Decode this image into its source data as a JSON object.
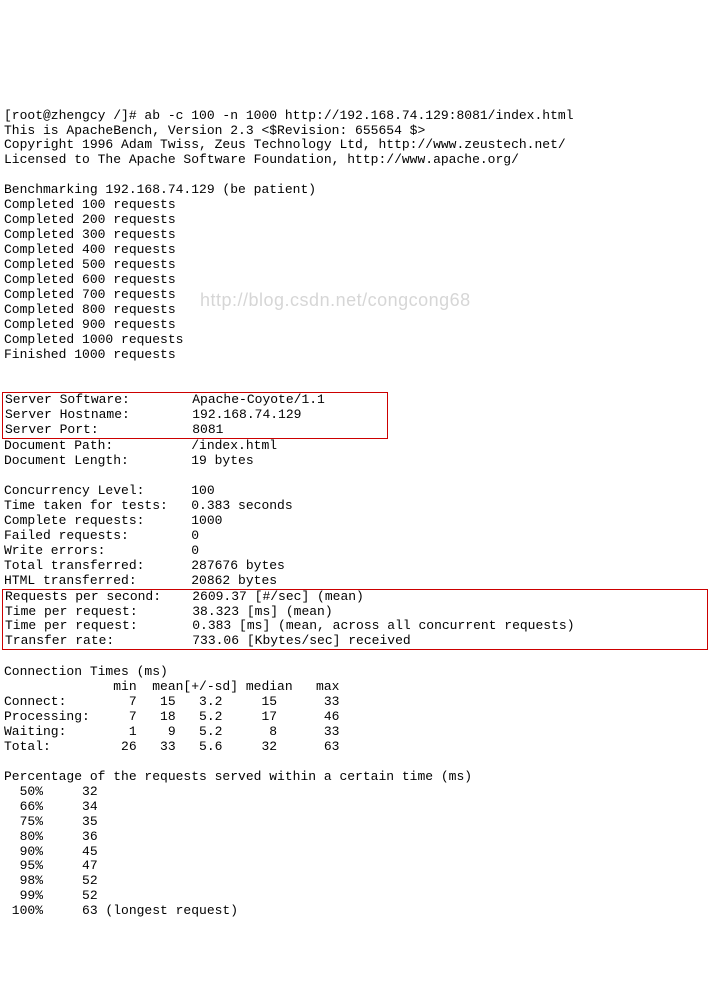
{
  "command": "[root@zhengcy /]# ab -c 100 -n 1000 http://192.168.74.129:8081/index.html",
  "header1": "This is ApacheBench, Version 2.3 <$Revision: 655654 $>",
  "header2": "Copyright 1996 Adam Twiss, Zeus Technology Ltd, http://www.zeustech.net/",
  "header3": "Licensed to The Apache Software Foundation, http://www.apache.org/",
  "bench_line": "Benchmarking 192.168.74.129 (be patient)",
  "c1": "Completed 100 requests",
  "c2": "Completed 200 requests",
  "c3": "Completed 300 requests",
  "c4": "Completed 400 requests",
  "c5": "Completed 500 requests",
  "c6": "Completed 600 requests",
  "c7": "Completed 700 requests",
  "c8": "Completed 800 requests",
  "c9": "Completed 900 requests",
  "c10": "Completed 1000 requests",
  "finished": "Finished 1000 requests",
  "server_info": "Server Software:        Apache-Coyote/1.1\nServer Hostname:        192.168.74.129\nServer Port:            8081",
  "doc_path": "Document Path:          /index.html",
  "doc_len": "Document Length:        19 bytes",
  "concurrency": "Concurrency Level:      100",
  "time_taken": "Time taken for tests:   0.383 seconds",
  "complete": "Complete requests:      1000",
  "failed": "Failed requests:        0",
  "write_err": "Write errors:           0",
  "total_tx": "Total transferred:      287676 bytes",
  "html_tx": "HTML transferred:       20862 bytes",
  "perf_block": "Requests per second:    2609.37 [#/sec] (mean)\nTime per request:       38.323 [ms] (mean)\nTime per request:       0.383 [ms] (mean, across all concurrent requests)\nTransfer rate:          733.06 [Kbytes/sec] received",
  "conn_header": "Connection Times (ms)",
  "conn_cols": "              min  mean[+/-sd] median   max",
  "conn_connect": "Connect:        7   15   3.2     15      33",
  "conn_proc": "Processing:     7   18   5.2     17      46",
  "conn_wait": "Waiting:        1    9   5.2      8      33",
  "conn_total": "Total:         26   33   5.6     32      63",
  "pct_header": "Percentage of the requests served within a certain time (ms)",
  "p50": "  50%     32",
  "p66": "  66%     34",
  "p75": "  75%     35",
  "p80": "  80%     36",
  "p90": "  90%     45",
  "p95": "  95%     47",
  "p98": "  98%     52",
  "p99": "  99%     52",
  "p100": " 100%     63 (longest request)",
  "watermark": "http://blog.csdn.net/congcong68"
}
